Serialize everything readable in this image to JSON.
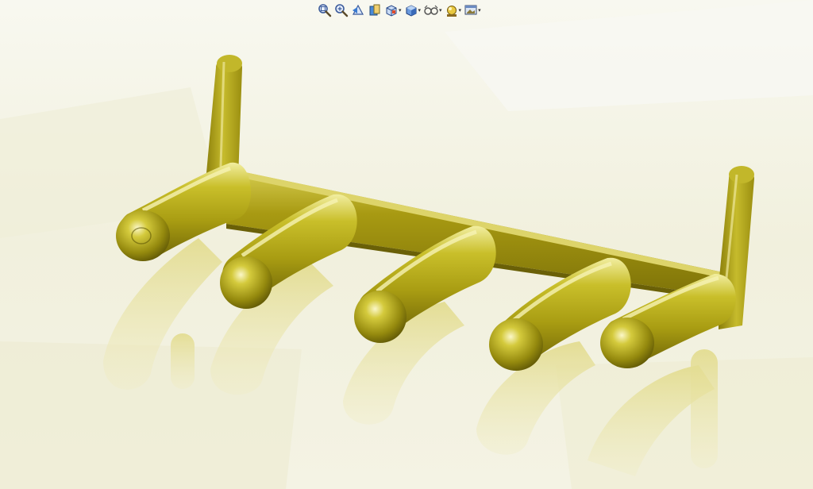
{
  "app": {
    "view": "3d-model-viewport"
  },
  "hud_toolbar": {
    "buttons": [
      {
        "id": "zoom-to-fit",
        "icon": "zoom-to-fit-icon",
        "has_dropdown": false
      },
      {
        "id": "zoom-to-area",
        "icon": "zoom-to-area-icon",
        "has_dropdown": false
      },
      {
        "id": "previous-view",
        "icon": "previous-view-icon",
        "has_dropdown": false
      },
      {
        "id": "section-view",
        "icon": "section-view-icon",
        "has_dropdown": false
      },
      {
        "id": "view-orientation",
        "icon": "view-orientation-icon",
        "has_dropdown": true
      },
      {
        "id": "display-style",
        "icon": "display-style-icon",
        "has_dropdown": true
      },
      {
        "id": "hide-show-items",
        "icon": "hide-show-items-icon",
        "has_dropdown": true
      },
      {
        "id": "edit-appearance",
        "icon": "edit-appearance-icon",
        "has_dropdown": true
      },
      {
        "id": "apply-scene",
        "icon": "apply-scene-icon",
        "has_dropdown": true
      }
    ]
  },
  "colors": {
    "model": "#b8ad1c",
    "model_dark": "#6e6406",
    "model_highlight": "#f4f0a8",
    "floor": "#f3f2e2",
    "floor_tile": "#eae8cf",
    "reflection": "#e6e0a0"
  }
}
